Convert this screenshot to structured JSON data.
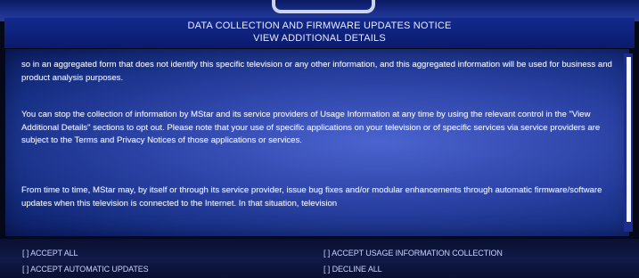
{
  "header": {
    "title": "DATA COLLECTION AND FIRMWARE UPDATES NOTICE",
    "subtitle": "VIEW ADDITIONAL DETAILS"
  },
  "body": {
    "paragraphs": [
      "so in an aggregated form that does not identify this specific television or any other information, and this aggregated information will be used for business and product analysis purposes.",
      "You can stop the collection of information by MStar and its service providers of Usage Information at any time by using the relevant control in the \"View Additional Details\" sections to opt out. Please note that your use of specific applications on your television or of specific services via service providers are subject to the Terms and Privacy Notices of those applications or services.",
      "From time to time, MStar may, by itself or through its service provider, issue bug fixes and/or modular enhancements through automatic firmware/software updates when this television is connected to the Internet. In that situation, television"
    ]
  },
  "options": {
    "accept_all": "[ ] ACCEPT ALL",
    "accept_automatic_updates": "[ ] ACCEPT AUTOMATIC UPDATES",
    "accept_usage_information": "[ ] ACCEPT USAGE INFORMATION COLLECTION",
    "decline_all": "[ ] DECLINE ALL"
  }
}
